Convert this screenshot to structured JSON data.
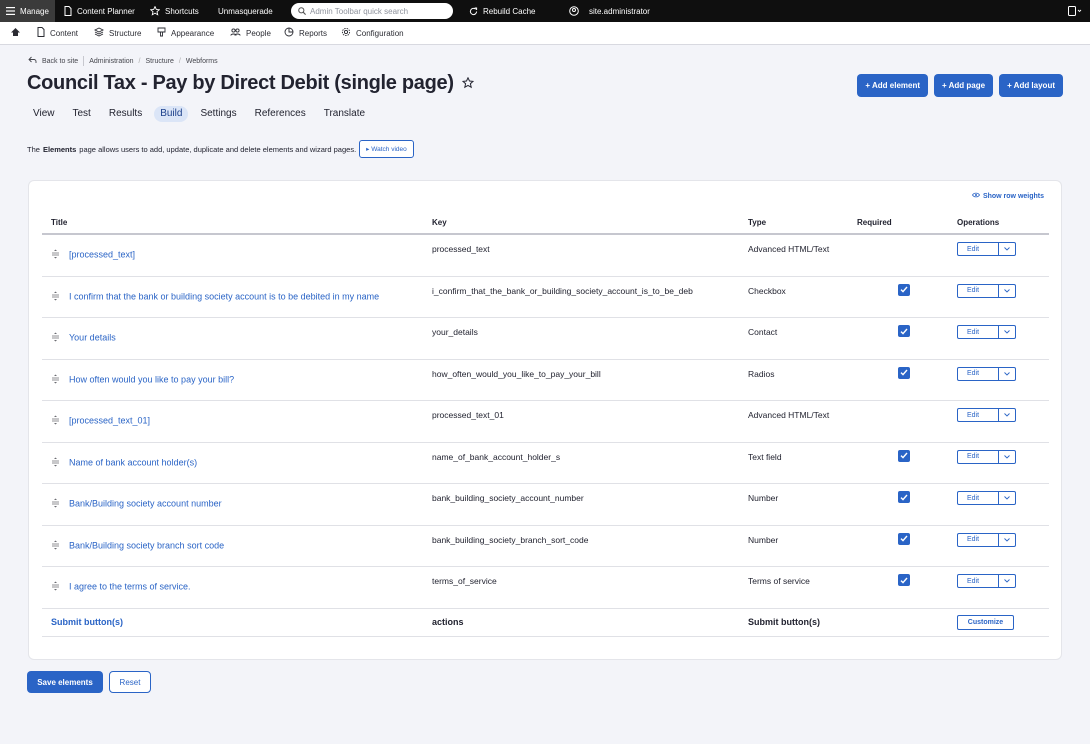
{
  "toolbar": {
    "manage": "Manage",
    "content_planner": "Content Planner",
    "shortcuts": "Shortcuts",
    "unmasquerade": "Unmasquerade",
    "search_placeholder": "Admin Toolbar quick search",
    "rebuild_cache": "Rebuild Cache",
    "user": "site.administrator"
  },
  "menu": {
    "content": "Content",
    "structure": "Structure",
    "appearance": "Appearance",
    "people": "People",
    "reports": "Reports",
    "configuration": "Configuration"
  },
  "breadcrumb": {
    "back": "Back to site",
    "items": [
      "Administration",
      "Structure",
      "Webforms"
    ]
  },
  "page": {
    "title": "Council Tax - Pay by Direct Debit (single page)",
    "buttons": [
      "+ Add element",
      "+ Add page",
      "+ Add layout"
    ],
    "tabs": [
      "View",
      "Test",
      "Results",
      "Build",
      "Settings",
      "References",
      "Translate"
    ],
    "active_tab": "Build",
    "desc_prefix": "The",
    "desc_bold": "Elements",
    "desc_text": "page allows users to add, update, duplicate and delete elements and wizard pages.",
    "watch_video": "▸ Watch video"
  },
  "table": {
    "show_row_weights": "Show row weights",
    "headers": [
      "Title",
      "Key",
      "Type",
      "Required",
      "Operations"
    ],
    "edit_label": "Edit",
    "rows": [
      {
        "title": "[processed_text]",
        "key": "processed_text",
        "type": "Advanced HTML/Text",
        "required": false
      },
      {
        "title": "I confirm that the bank or building society account is to be debited in my name",
        "key": "i_confirm_that_the_bank_or_building_society_account_is_to_be_deb",
        "type": "Checkbox",
        "required": true
      },
      {
        "title": "Your details",
        "key": "your_details",
        "type": "Contact",
        "required": true
      },
      {
        "title": "How often would you like to pay your bill?",
        "key": "how_often_would_you_like_to_pay_your_bill",
        "type": "Radios",
        "required": true
      },
      {
        "title": "[processed_text_01]",
        "key": "processed_text_01",
        "type": "Advanced HTML/Text",
        "required": false
      },
      {
        "title": "Name of bank account holder(s)",
        "key": "name_of_bank_account_holder_s",
        "type": "Text field",
        "required": true
      },
      {
        "title": "Bank/Building society account number",
        "key": "bank_building_society_account_number",
        "type": "Number",
        "required": true
      },
      {
        "title": "Bank/Building society branch sort code",
        "key": "bank_building_society_branch_sort_code",
        "type": "Number",
        "required": true
      },
      {
        "title": "I agree to the terms of service.",
        "key": "terms_of_service",
        "type": "Terms of service",
        "required": true
      }
    ],
    "submit_row": {
      "title": "Submit button(s)",
      "key": "actions",
      "type": "Submit button(s)",
      "operation": "Customize"
    }
  },
  "footer": {
    "save": "Save elements",
    "reset": "Reset"
  },
  "colors": {
    "accent": "#2a64c6",
    "toolbar": "#0f0f0f"
  }
}
